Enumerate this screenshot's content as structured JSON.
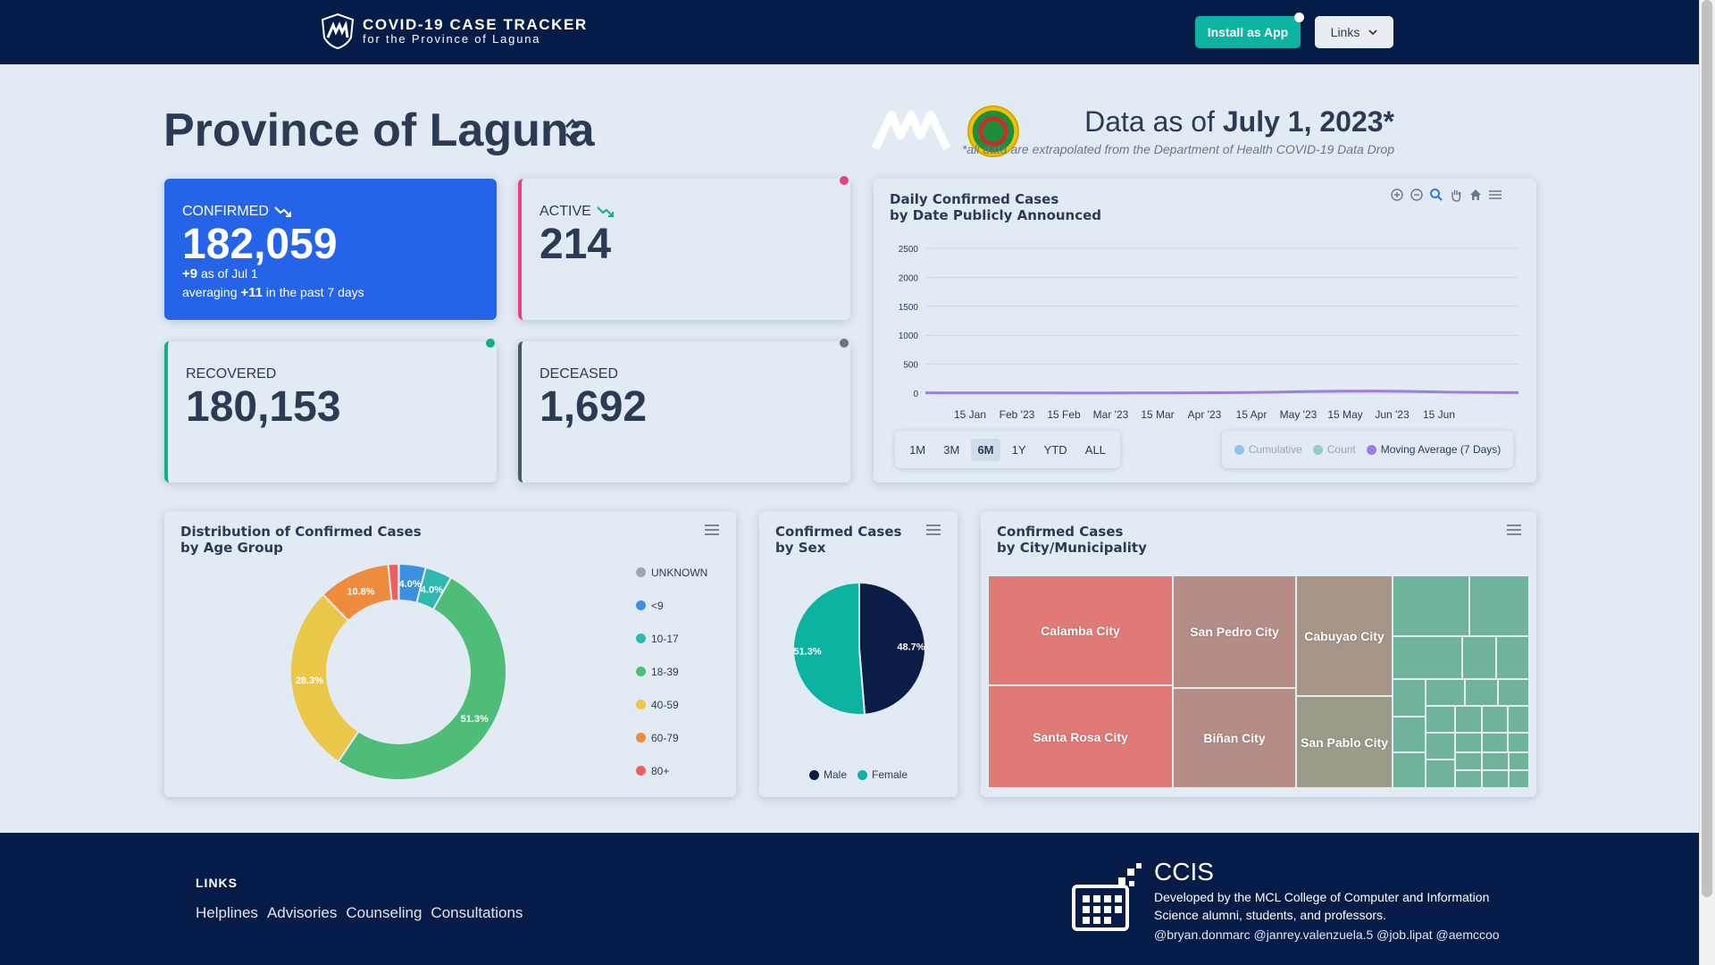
{
  "header": {
    "title": "COVID-19 CASE TRACKER",
    "subtitle": "for the Province of Laguna",
    "install_label": "Install as App",
    "links_label": "Links"
  },
  "page": {
    "title": "Province of Laguna",
    "data_as_of_prefix": "Data as of ",
    "data_as_of_date": "July 1, 2023*",
    "note": "*all data are extrapolated from the Department of Health COVID-19 Data Drop"
  },
  "stats": {
    "confirmed": {
      "label": "CONFIRMED",
      "value": "182,059",
      "delta": "+9",
      "delta_suffix": " as of Jul 1",
      "avg_prefix": "averaging ",
      "avg": "+11",
      "avg_suffix": " in the past 7 days"
    },
    "active": {
      "label": "ACTIVE",
      "value": "214"
    },
    "recovered": {
      "label": "RECOVERED",
      "value": "180,153"
    },
    "deceased": {
      "label": "DECEASED",
      "value": "1,692"
    }
  },
  "colors": {
    "confirmed": "#2563e8",
    "active": "#e83e8c",
    "recovered": "#10b17e",
    "deceased": "#4a5568",
    "teal": "#0cb3a0",
    "navy": "#051c48"
  },
  "daily_chart": {
    "title_line1": "Daily Confirmed Cases",
    "title_line2": "by Date Publicly Announced",
    "ranges": [
      "1M",
      "3M",
      "6M",
      "1Y",
      "YTD",
      "ALL"
    ],
    "selected_range": "6M",
    "legend": [
      {
        "name": "Cumulative",
        "color": "#90c2ee"
      },
      {
        "name": "Count",
        "color": "#8fcfc8"
      },
      {
        "name": "Moving Average (7 Days)",
        "color": "#9b7fe0"
      }
    ],
    "toolbar_icons": [
      "zoom-in-icon",
      "zoom-out-icon",
      "selection-zoom-icon",
      "pan-hand-icon",
      "home-icon",
      "menu-icon"
    ]
  },
  "age_chart": {
    "title_line1": "Distribution of Confirmed Cases",
    "title_line2": "by Age Group"
  },
  "sex_chart": {
    "title_line1": "Confirmed Cases",
    "title_line2": "by Sex"
  },
  "city_chart": {
    "title_line1": "Confirmed Cases",
    "title_line2": "by City/Municipality",
    "named": [
      "Calamba City",
      "Santa Rosa City",
      "San Pedro City",
      "Biñan City",
      "Cabuyao City",
      "San Pablo City"
    ]
  },
  "chart_data": [
    {
      "type": "line",
      "title": "Daily Confirmed Cases by Date Publicly Announced",
      "x_ticks": [
        "15 Jan",
        "Feb '23",
        "15 Feb",
        "Mar '23",
        "15 Mar",
        "Apr '23",
        "15 Apr",
        "May '23",
        "15 May",
        "Jun '23",
        "15 Jun"
      ],
      "y_ticks": [
        0,
        500,
        1000,
        1500,
        2000,
        2500
      ],
      "ylim": [
        0,
        2500
      ],
      "series": [
        {
          "name": "Moving Average (7 Days)",
          "values": [
            5,
            4,
            3,
            4,
            3,
            2,
            2,
            3,
            4,
            5,
            8,
            12,
            20,
            28,
            34,
            36,
            32,
            24,
            16,
            12,
            10
          ]
        }
      ],
      "grid": true,
      "legend": "bottom-right"
    },
    {
      "type": "pie",
      "title": "Distribution of Confirmed Cases by Age Group",
      "donut": true,
      "categories": [
        "UNKNOWN",
        "<9",
        "10-17",
        "18-39",
        "40-59",
        "60-79",
        "80+"
      ],
      "values": [
        0.1,
        4.0,
        4.0,
        51.3,
        28.3,
        10.8,
        1.5
      ],
      "labels": [
        "",
        "4.0%",
        "4.0%",
        "51.3%",
        "28.3%",
        "10.8%",
        ""
      ],
      "colors": [
        "#a0a7b4",
        "#3d8fe0",
        "#2fb7b0",
        "#4dbd78",
        "#ebc74a",
        "#ef8b3c",
        "#ef5e5e"
      ],
      "legend": "right"
    },
    {
      "type": "pie",
      "title": "Confirmed Cases by Sex",
      "categories": [
        "Male",
        "Female"
      ],
      "values": [
        48.7,
        51.3
      ],
      "labels": [
        "48.7%",
        "51.3%"
      ],
      "colors": [
        "#0b1c46",
        "#0cb3a0"
      ],
      "legend": "bottom"
    }
  ],
  "footer": {
    "links_heading": "LINKS",
    "links": [
      "Helplines",
      "Advisories",
      "Counseling",
      "Consultations"
    ],
    "org": "CCIS",
    "desc": "Developed by the MCL College of Computer and Information Science alumni, students, and professors.",
    "handles": "@bryan.donmarc @janrey.valenzuela.5 @job.lipat @aemccoo"
  }
}
